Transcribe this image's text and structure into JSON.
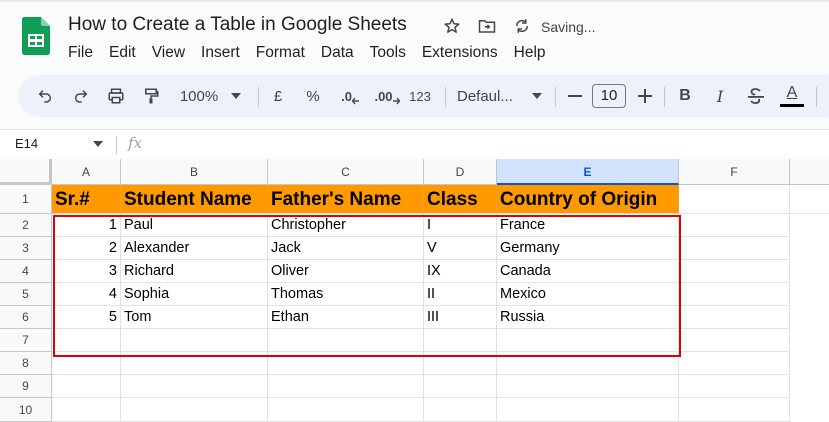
{
  "doc": {
    "title": "How to Create a Table in Google Sheets",
    "status": "Saving..."
  },
  "icons": {
    "logo": "sheets-logo",
    "star": "star-icon",
    "move": "folder-move-icon",
    "sync": "sync-icon"
  },
  "menu": [
    "File",
    "Edit",
    "View",
    "Insert",
    "Format",
    "Data",
    "Tools",
    "Extensions",
    "Help"
  ],
  "toolbar": {
    "zoom": "100%",
    "currency": "£",
    "percent": "%",
    "dec_decrease": ".0",
    "dec_increase": ".00",
    "number_format": "123",
    "font": "Defaul...",
    "font_size": "10",
    "bold": "B",
    "italic": "I",
    "text_color": "A"
  },
  "formula_bar": {
    "name_box": "E14",
    "fx": "fx"
  },
  "colors": {
    "header_fill": "#ff9900",
    "selection": "#d3e3fd",
    "highlight_border": "#e00000",
    "accent": "#0f9d58"
  },
  "sheet": {
    "columns": [
      "A",
      "B",
      "C",
      "D",
      "E",
      "F"
    ],
    "selected_column": "E",
    "rows": [
      "1",
      "2",
      "3",
      "4",
      "5",
      "6",
      "7",
      "8",
      "9",
      "10"
    ],
    "headers": [
      "Sr.#",
      "Student Name",
      "Father's Name",
      "Class",
      "Country of Origin"
    ],
    "data": [
      [
        "1",
        "Paul",
        "Christopher",
        "I",
        "France"
      ],
      [
        "2",
        "Alexander",
        "Jack",
        "V",
        "Germany"
      ],
      [
        "3",
        "Richard",
        "Oliver",
        "IX",
        "Canada"
      ],
      [
        "4",
        "Sophia",
        "Thomas",
        "II",
        "Mexico"
      ],
      [
        "5",
        "Tom",
        "Ethan",
        "III",
        "Russia"
      ]
    ]
  }
}
